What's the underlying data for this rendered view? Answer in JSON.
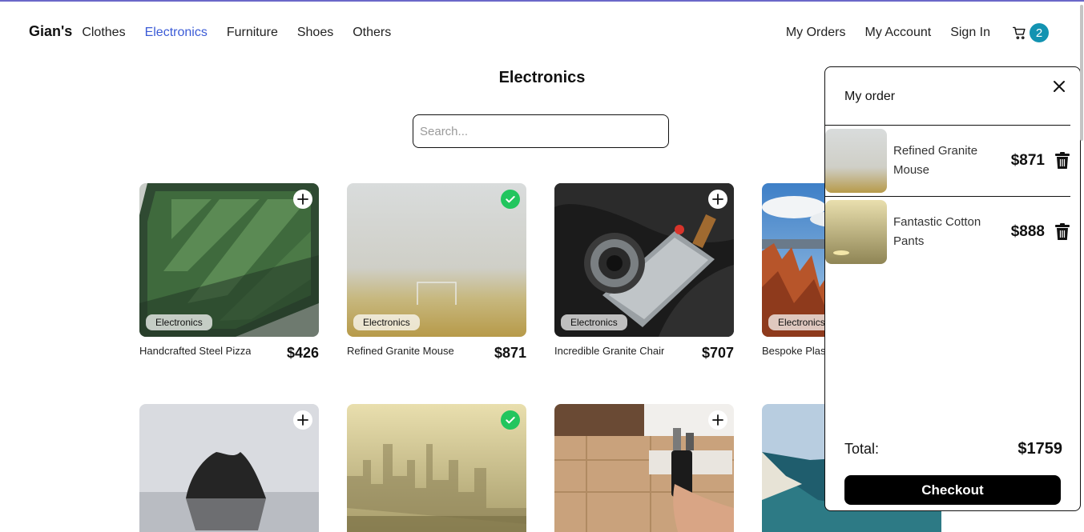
{
  "nav": {
    "brand": "Gian's",
    "links": [
      "Clothes",
      "Electronics",
      "Furniture",
      "Shoes",
      "Others"
    ],
    "right_links": [
      "My Orders",
      "My Account",
      "Sign In"
    ],
    "cart_count": "2"
  },
  "main": {
    "title": "Electronics",
    "search_placeholder": "Search..."
  },
  "products": [
    {
      "category": "Electronics",
      "name": "Handcrafted Steel Pizza",
      "price": "$426",
      "in_cart": false
    },
    {
      "category": "Electronics",
      "name": "Refined Granite Mouse",
      "price": "$871",
      "in_cart": true
    },
    {
      "category": "Electronics",
      "name": "Incredible Granite Chair",
      "price": "$707",
      "in_cart": false
    },
    {
      "category": "Electronics",
      "name": "Bespoke Plast",
      "price": "",
      "in_cart": false
    },
    {
      "category": "",
      "name": "",
      "price": "",
      "in_cart": false
    },
    {
      "category": "",
      "name": "",
      "price": "",
      "in_cart": true
    },
    {
      "category": "",
      "name": "",
      "price": "",
      "in_cart": false
    },
    {
      "category": "",
      "name": "",
      "price": "",
      "in_cart": false
    }
  ],
  "order_panel": {
    "title": "My order",
    "items": [
      {
        "name": "Refined Granite Mouse",
        "price": "$871"
      },
      {
        "name": "Fantastic Cotton Pants",
        "price": "$888"
      }
    ],
    "total_label": "Total:",
    "total_value": "$1759",
    "checkout_label": "Checkout"
  },
  "icons": {
    "cart": "cart-icon",
    "add": "plus-icon",
    "added": "check-icon",
    "close": "close-icon",
    "delete": "trash-icon"
  },
  "colors": {
    "active_link": "#3b5bd6",
    "badge": "#1393b1",
    "check": "#22c55e",
    "checkout_bg": "#000000"
  }
}
